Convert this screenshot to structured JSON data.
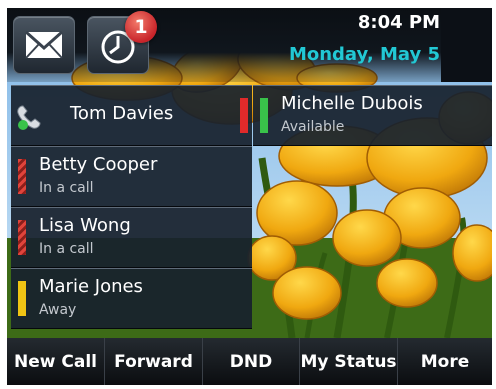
{
  "header": {
    "time": "8:04 PM",
    "date": "Monday, May 5",
    "messages_icon": "envelope-icon",
    "history_icon": "clock-icon",
    "missed_badge": "1"
  },
  "lines": [
    {
      "name": "Tom Davies",
      "status": "",
      "indicator": "phone-handset-icon"
    },
    {
      "name": "Betty Cooper",
      "status": "In a call",
      "indicator": "red-striped-bar"
    },
    {
      "name": "Lisa Wong",
      "status": "In a call",
      "indicator": "red-striped-bar"
    },
    {
      "name": "Marie Jones",
      "status": "Away",
      "indicator": "yellow-bar"
    }
  ],
  "favorites": [
    {
      "name": "Michelle Dubois",
      "status": "Available",
      "indicator": "green-bar"
    }
  ],
  "colors": {
    "accent_date": "#22c8d4",
    "busy": "#e02a2a",
    "away": "#f0c414",
    "available": "#39c24a",
    "badge": "#c8242a"
  },
  "softkeys": [
    "New Call",
    "Forward",
    "DND",
    "My Status",
    "More"
  ]
}
